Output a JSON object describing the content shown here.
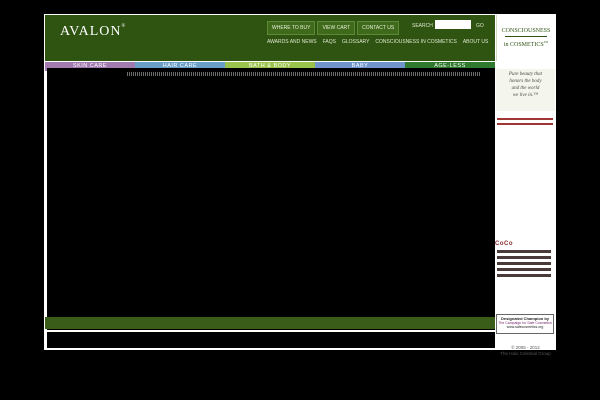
{
  "header": {
    "logo": "AVALON",
    "logo_mark": "®",
    "top_nav": [
      "WHERE TO BUY",
      "VIEW CART",
      "CONTACT US"
    ],
    "search_label": "SEARCH",
    "search_value": "",
    "go_label": "GO",
    "secondary_nav": [
      "AWARDS AND NEWS",
      "FAQS",
      "GLOSSARY",
      "CONSCIOUSNESS IN COSMETICS",
      "ABOUT US"
    ]
  },
  "categories": [
    {
      "label": "SKIN CARE",
      "color": "#a17ab0"
    },
    {
      "label": "HAIR CARE",
      "color": "#6aa0c8"
    },
    {
      "label": "BATH & BODY",
      "color": "#9cc24e"
    },
    {
      "label": "BABY",
      "color": "#6f95cc"
    },
    {
      "label": "AGE-LESS",
      "color": "#2f7a2f"
    }
  ],
  "sidebar": {
    "cic_line1": "CONSCIOUSNESS",
    "cic_line2": "in COSMETICS",
    "cic_mark": "TM",
    "tagline": [
      "Pure beauty that",
      "honors the body",
      "and the world",
      "we live in.™"
    ],
    "promo_title": "CoCo",
    "champion_line1": "Designated Champion by",
    "champion_line2": "The Campaign for Safe Cosmetics",
    "champion_line3": "www.safecosmetics.org"
  },
  "footer": {
    "copyright": "© 2005 - 2012",
    "company": "The Hain Celestial Group"
  },
  "colors": {
    "header_green": "#2f5412",
    "footer_green": "#3a5e1a",
    "accent_red": "#a03535"
  }
}
